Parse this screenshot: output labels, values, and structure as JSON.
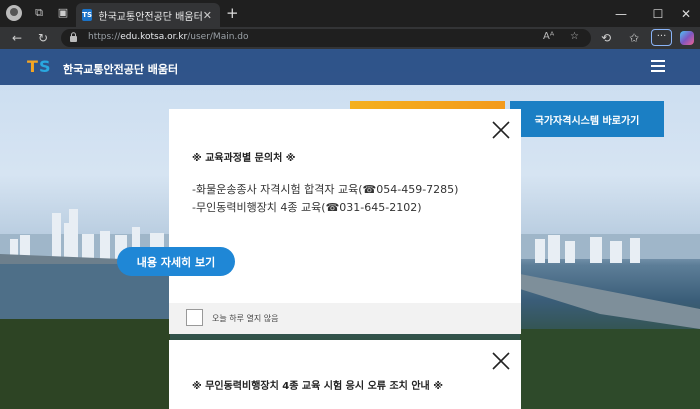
{
  "browser": {
    "tab_title": "한국교통안전공단 배움터",
    "url_host": "edu.kotsa.or.kr",
    "url_prefix": "https://",
    "url_path": "/user/Main.do"
  },
  "site": {
    "logo_text": "한국교통안전공단 배움터",
    "national_button": "국가자격시스템 바로가기"
  },
  "popup1": {
    "heading": "※ 교육과정별 문의처 ※",
    "lines": [
      "-화물운송종사 자격시험 합격자 교육(☎054-459-7285)",
      "-무인동력비행장치 4종 교육(☎031-645-2102)"
    ],
    "more_button": "내용 자세히 보기",
    "dont_show_label": "오늘 하루 열지 않음"
  },
  "popup2": {
    "heading": "※ 무인동력비행장치 4종 교육 시험 응시 오류 조치 안내 ※"
  },
  "colors": {
    "brand_blue": "#1b7fc4",
    "button_blue": "#1f87d6",
    "orange": "#f4b01f"
  }
}
